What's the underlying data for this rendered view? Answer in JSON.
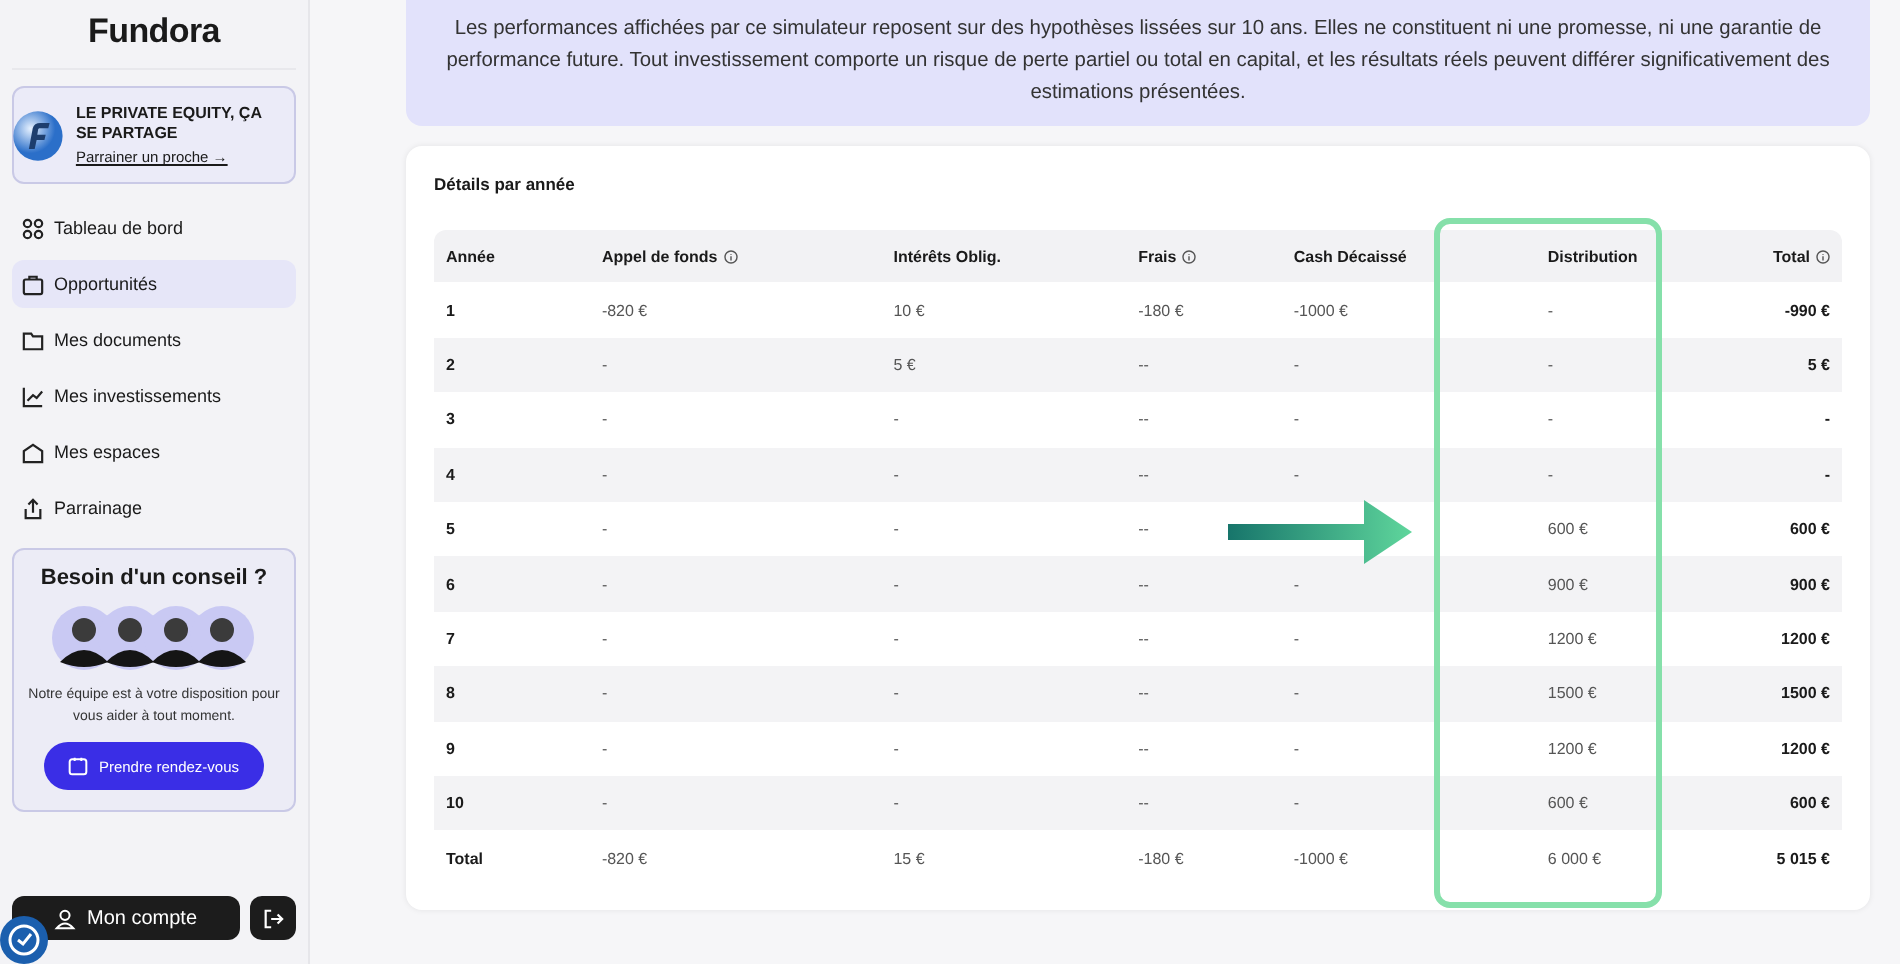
{
  "sidebar": {
    "logo": "Fundora",
    "promo": {
      "title": "LE PRIVATE EQUITY, ÇA SE PARTAGE",
      "link": "Parrainer un proche →"
    },
    "items": [
      {
        "label": "Tableau de bord",
        "selected": false
      },
      {
        "label": "Opportunités",
        "selected": true
      },
      {
        "label": "Mes documents",
        "selected": false
      },
      {
        "label": "Mes investissements",
        "selected": false
      },
      {
        "label": "Mes espaces",
        "selected": false
      },
      {
        "label": "Parrainage",
        "selected": false
      }
    ],
    "advice": {
      "title": "Besoin d'un conseil ?",
      "text": "Notre équipe est à votre disposition pour vous aider à tout moment.",
      "button": "Prendre rendez-vous"
    },
    "account_button": "Mon compte"
  },
  "disclaimer": "Les performances affichées par ce simulateur reposent sur des hypothèses lissées sur 10 ans. Elles ne constituent ni une promesse, ni une garantie de performance future. Tout investissement comporte un risque de perte partiel ou total en capital, et les résultats réels peuvent différer significativement des estimations présentées.",
  "table": {
    "title": "Détails par année",
    "columns": [
      {
        "label": "Année",
        "info": false
      },
      {
        "label": "Appel de fonds",
        "info": true
      },
      {
        "label": "Intérêts Oblig.",
        "info": false
      },
      {
        "label": "Frais",
        "info": true
      },
      {
        "label": "Cash Décaissé",
        "info": false
      },
      {
        "label": "Distribution",
        "info": false
      },
      {
        "label": "Total",
        "info": true
      }
    ],
    "rows": [
      {
        "annee": "1",
        "appel": "-820 €",
        "interets": "10 €",
        "frais": "-180 €",
        "cash": "-1000 €",
        "distribution": "-",
        "total": "-990 €"
      },
      {
        "annee": "2",
        "appel": "-",
        "interets": "5 €",
        "frais": "--",
        "cash": "-",
        "distribution": "-",
        "total": "5 €"
      },
      {
        "annee": "3",
        "appel": "-",
        "interets": "-",
        "frais": "--",
        "cash": "-",
        "distribution": "-",
        "total": "-"
      },
      {
        "annee": "4",
        "appel": "-",
        "interets": "-",
        "frais": "--",
        "cash": "-",
        "distribution": "-",
        "total": "-"
      },
      {
        "annee": "5",
        "appel": "-",
        "interets": "-",
        "frais": "--",
        "distribution": "600 €",
        "total": "600 €"
      },
      {
        "annee": "6",
        "appel": "-",
        "interets": "-",
        "frais": "--",
        "cash": "-",
        "distribution": "900 €",
        "total": "900 €"
      },
      {
        "annee": "7",
        "appel": "-",
        "interets": "-",
        "frais": "--",
        "cash": "-",
        "distribution": "1200 €",
        "total": "1200 €"
      },
      {
        "annee": "8",
        "appel": "-",
        "interets": "-",
        "frais": "--",
        "cash": "-",
        "distribution": "1500 €",
        "total": "1500 €"
      },
      {
        "annee": "9",
        "appel": "-",
        "interets": "-",
        "frais": "--",
        "cash": "-",
        "distribution": "1200 €",
        "total": "1200 €"
      },
      {
        "annee": "10",
        "appel": "-",
        "interets": "-",
        "frais": "--",
        "cash": "-",
        "distribution": "600 €",
        "total": "600 €"
      }
    ],
    "total_row": {
      "annee": "Total",
      "appel": "-820 €",
      "interets": "15 €",
      "frais": "-180 €",
      "cash": "-1000 €",
      "distribution": "6 000 €",
      "total": "5 015 €"
    }
  }
}
